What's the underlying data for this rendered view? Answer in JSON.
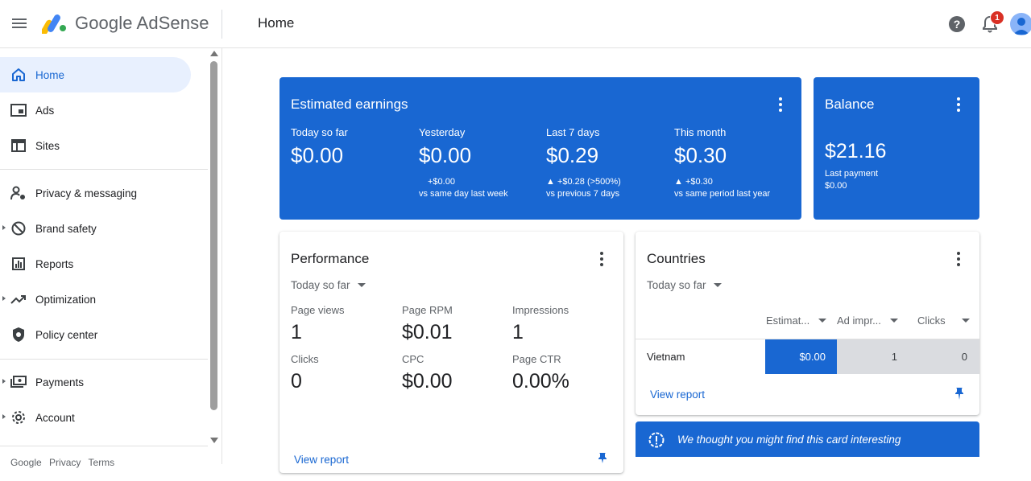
{
  "app": {
    "brand": "Google AdSense",
    "page_title": "Home",
    "notifications_count": "1"
  },
  "sidebar": {
    "items": [
      {
        "label": "Home",
        "icon": "home-icon"
      },
      {
        "label": "Ads",
        "icon": "ads-icon"
      },
      {
        "label": "Sites",
        "icon": "sites-icon"
      },
      {
        "label": "Privacy & messaging",
        "icon": "privacy-icon"
      },
      {
        "label": "Brand safety",
        "icon": "block-icon"
      },
      {
        "label": "Reports",
        "icon": "reports-icon"
      },
      {
        "label": "Optimization",
        "icon": "trending-icon"
      },
      {
        "label": "Policy center",
        "icon": "shield-icon"
      },
      {
        "label": "Payments",
        "icon": "payments-icon"
      },
      {
        "label": "Account",
        "icon": "gear-icon"
      }
    ],
    "footer": {
      "google": "Google",
      "privacy": "Privacy",
      "terms": "Terms"
    }
  },
  "earnings": {
    "title": "Estimated earnings",
    "metrics": [
      {
        "label": "Today so far",
        "value": "$0.00",
        "delta": "",
        "compare": ""
      },
      {
        "label": "Yesterday",
        "value": "$0.00",
        "delta": "+$0.00",
        "compare": "vs same day last week"
      },
      {
        "label": "Last 7 days",
        "value": "$0.29",
        "delta": "▲ +$0.28 (>500%)",
        "compare": "vs previous 7 days"
      },
      {
        "label": "This month",
        "value": "$0.30",
        "delta": "▲ +$0.30",
        "compare": "vs same period last year"
      }
    ]
  },
  "balance": {
    "title": "Balance",
    "value": "$21.16",
    "last_payment_label": "Last payment",
    "last_payment_value": "$0.00"
  },
  "performance": {
    "title": "Performance",
    "range": "Today so far",
    "metrics": [
      {
        "label": "Page views",
        "value": "1"
      },
      {
        "label": "Page RPM",
        "value": "$0.01"
      },
      {
        "label": "Impressions",
        "value": "1"
      },
      {
        "label": "Clicks",
        "value": "0"
      },
      {
        "label": "CPC",
        "value": "$0.00"
      },
      {
        "label": "Page CTR",
        "value": "0.00%"
      }
    ],
    "view_report": "View report"
  },
  "countries": {
    "title": "Countries",
    "range": "Today so far",
    "columns": [
      "Estimat...",
      "Ad impr...",
      "Clicks"
    ],
    "rows": [
      {
        "country": "Vietnam",
        "earnings": "$0.00",
        "impressions": "1",
        "clicks": "0"
      }
    ],
    "view_report": "View report"
  },
  "banner": {
    "text": "We thought you might find this card interesting"
  },
  "colors": {
    "accent": "#1967d2",
    "active_nav_bg": "#e8f0fe",
    "badge": "#d93025"
  }
}
